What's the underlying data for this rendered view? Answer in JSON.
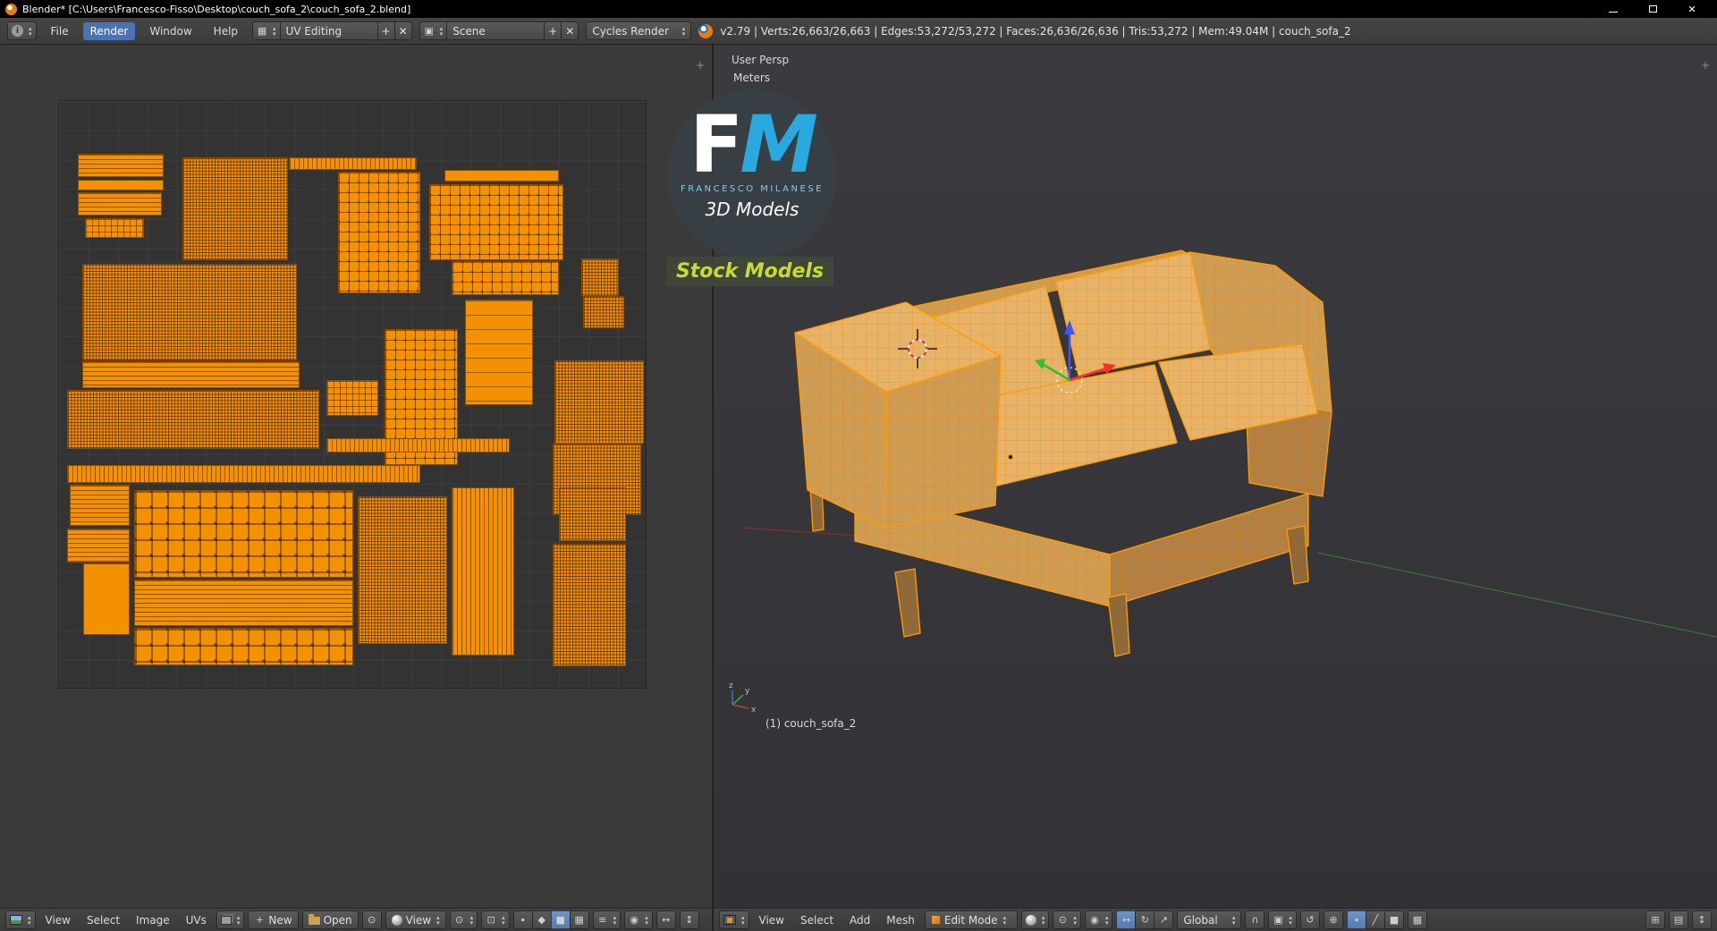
{
  "titlebar": {
    "title": "Blender* [C:\\Users\\Francesco-Fisso\\Desktop\\couch_sofa_2\\couch_sofa_2.blend]",
    "close_glyph": "✕"
  },
  "topbar": {
    "file": "File",
    "render": "Render",
    "window": "Window",
    "help": "Help",
    "layout": "UV Editing",
    "scene": "Scene",
    "engine": "Cycles Render",
    "stats": "v2.79 | Verts:26,663/26,663 | Edges:53,272/53,272 | Faces:26,636/26,636 | Tris:53,272 | Mem:49.04M | couch_sofa_2"
  },
  "icons": {
    "i": "i",
    "plus": "+",
    "close": "✕",
    "pin": "⊙",
    "pivot": "⊙",
    "snap": "⊡",
    "prop": "◉",
    "sticky": "≡",
    "uv_modes": [
      "∙",
      "◆",
      "■",
      "▦"
    ],
    "h_arrows": "↔",
    "v_arrows": "↕",
    "rotate": "↻",
    "scale": "↗",
    "magnet": "∩",
    "snap_elem": "▣",
    "undo": "↺",
    "add": "⊕",
    "vef": [
      "∙",
      "╱",
      "■"
    ],
    "occlude": "▦",
    "grid": "⊞",
    "sheet": "▤",
    "expand": "+",
    "layout_ic": "▦",
    "scene_ic": "▣"
  },
  "uv_editor": {
    "menus": {
      "view": "View",
      "select": "Select",
      "image": "Image",
      "uvs": "UVs"
    },
    "new_label": "New",
    "open_label": "Open",
    "view_dropdown": "View",
    "islands": [
      [
        87,
        122,
        96,
        26,
        "sh"
      ],
      [
        87,
        151,
        96,
        12,
        "solid"
      ],
      [
        87,
        165,
        94,
        26,
        "sh"
      ],
      [
        95,
        194,
        66,
        22,
        "grid"
      ],
      [
        204,
        126,
        118,
        115,
        "dense"
      ],
      [
        323,
        126,
        143,
        14,
        "sv"
      ],
      [
        378,
        142,
        92,
        136,
        "checker"
      ],
      [
        480,
        156,
        150,
        85,
        "checker"
      ],
      [
        497,
        140,
        128,
        13,
        "solid"
      ],
      [
        505,
        242,
        120,
        38,
        "checker"
      ],
      [
        650,
        239,
        42,
        42,
        "dense"
      ],
      [
        652,
        281,
        46,
        36,
        "dense"
      ],
      [
        92,
        245,
        240,
        108,
        "dense"
      ],
      [
        92,
        354,
        243,
        30,
        "sh"
      ],
      [
        75,
        386,
        282,
        66,
        "dense"
      ],
      [
        365,
        375,
        58,
        40,
        "grid"
      ],
      [
        430,
        318,
        82,
        152,
        "checker"
      ],
      [
        520,
        285,
        76,
        118,
        "sparse"
      ],
      [
        620,
        353,
        100,
        93,
        "dense"
      ],
      [
        618,
        446,
        99,
        80,
        "dense"
      ],
      [
        75,
        470,
        395,
        20,
        "sv"
      ],
      [
        78,
        492,
        67,
        46,
        "sh"
      ],
      [
        75,
        541,
        70,
        38,
        "sh"
      ],
      [
        93,
        580,
        52,
        80,
        "solid"
      ],
      [
        150,
        498,
        245,
        98,
        "cb"
      ],
      [
        150,
        598,
        245,
        52,
        "sh"
      ],
      [
        150,
        652,
        245,
        42,
        "cb"
      ],
      [
        400,
        505,
        100,
        165,
        "dense"
      ],
      [
        505,
        495,
        70,
        188,
        "sv"
      ],
      [
        625,
        495,
        75,
        60,
        "dense"
      ],
      [
        618,
        558,
        82,
        137,
        "dense"
      ],
      [
        365,
        440,
        205,
        16,
        "sv"
      ]
    ]
  },
  "viewport": {
    "persp_label": "User Persp",
    "unit_label": "Meters",
    "object_label": "(1) couch_sofa_2",
    "menus": {
      "view": "View",
      "select": "Select",
      "add": "Add",
      "mesh": "Mesh"
    },
    "mode": "Edit Mode",
    "orientation": "Global",
    "axis_labels": {
      "x": "x",
      "y": "y",
      "z": "z"
    }
  },
  "logo": {
    "f": "F",
    "m": "M",
    "name": "FRANCESCO MILANESE",
    "sub": "3D Models",
    "band": "Stock Models"
  }
}
